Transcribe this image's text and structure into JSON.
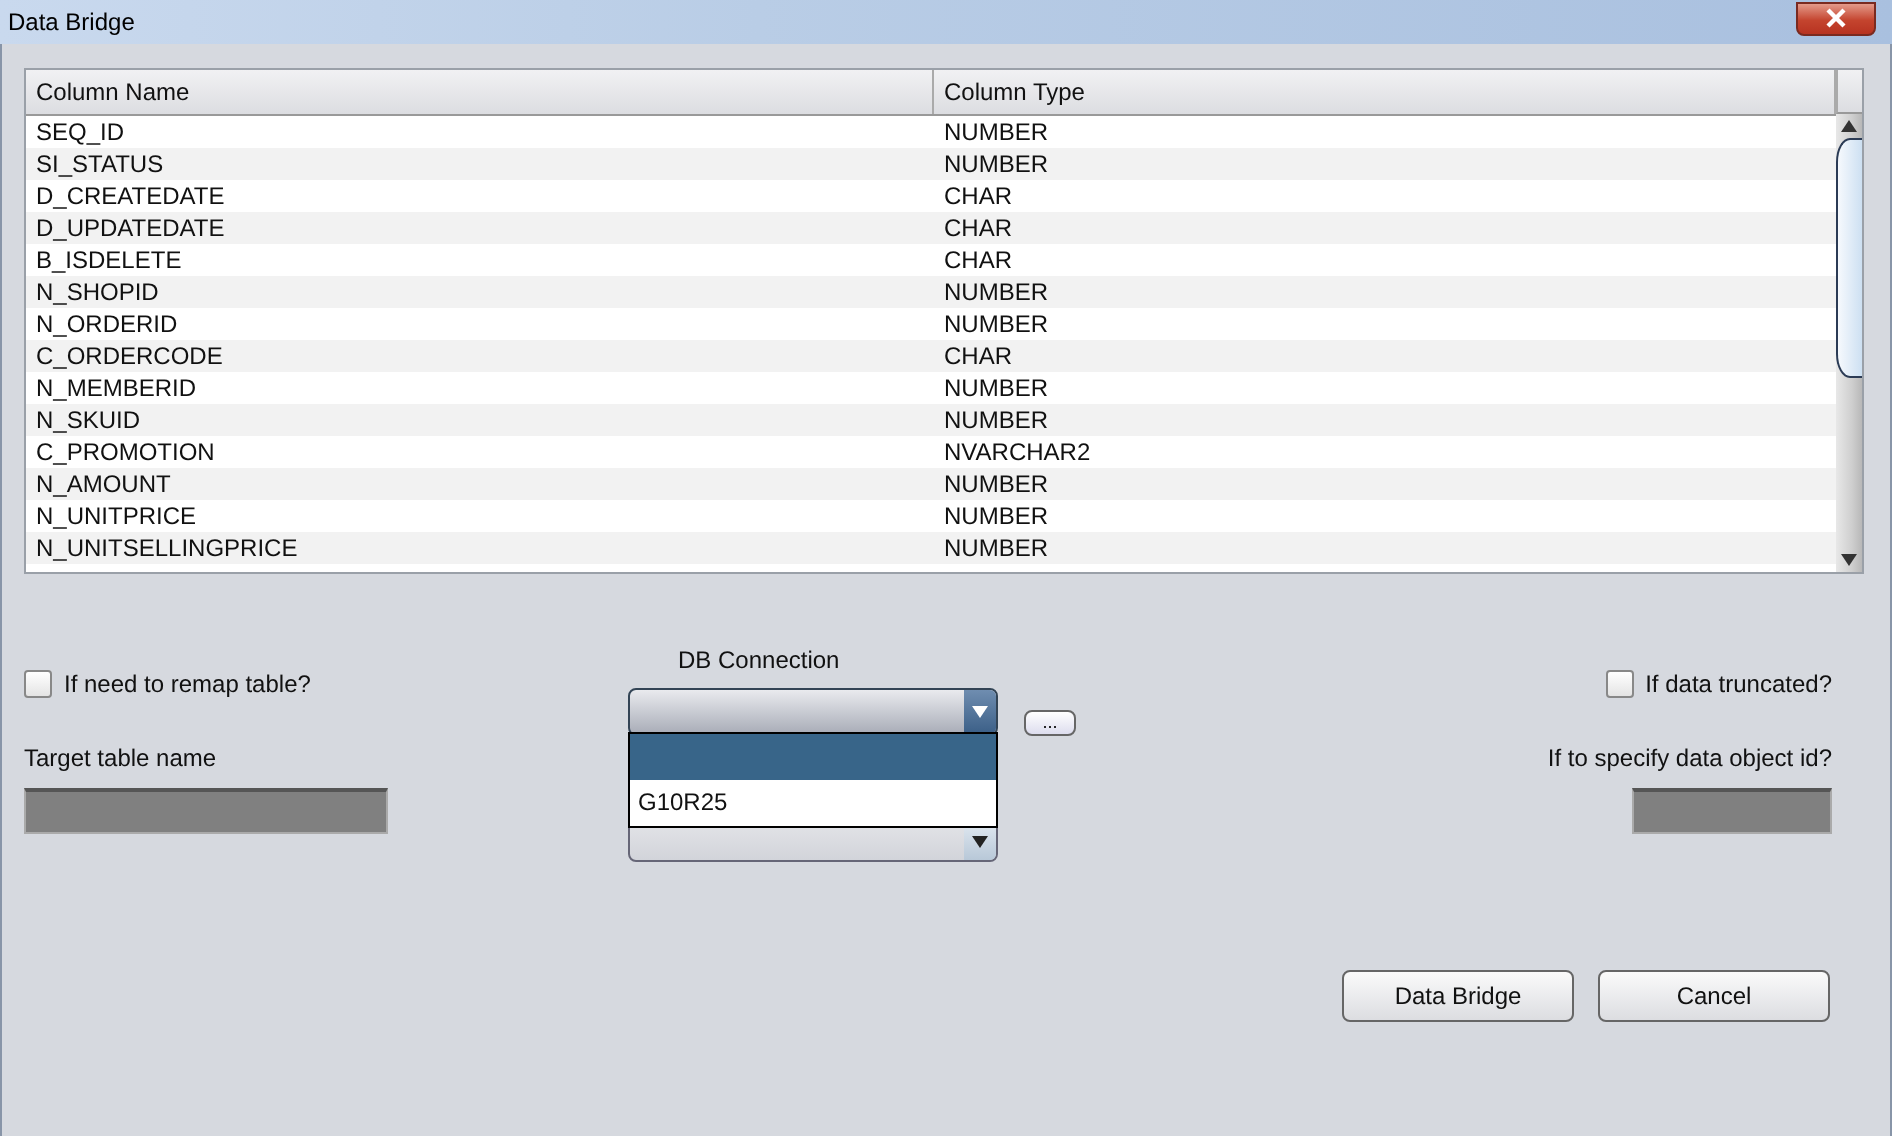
{
  "window": {
    "title": "Data Bridge"
  },
  "table": {
    "columns": [
      "Column Name",
      "Column Type"
    ],
    "rows": [
      {
        "name": "SEQ_ID",
        "type": "NUMBER"
      },
      {
        "name": "SI_STATUS",
        "type": "NUMBER"
      },
      {
        "name": "D_CREATEDATE",
        "type": "CHAR"
      },
      {
        "name": "D_UPDATEDATE",
        "type": "CHAR"
      },
      {
        "name": "B_ISDELETE",
        "type": "CHAR"
      },
      {
        "name": "N_SHOPID",
        "type": "NUMBER"
      },
      {
        "name": "N_ORDERID",
        "type": "NUMBER"
      },
      {
        "name": "C_ORDERCODE",
        "type": "CHAR"
      },
      {
        "name": "N_MEMBERID",
        "type": "NUMBER"
      },
      {
        "name": "N_SKUID",
        "type": "NUMBER"
      },
      {
        "name": "C_PROMOTION",
        "type": "NVARCHAR2"
      },
      {
        "name": "N_AMOUNT",
        "type": "NUMBER"
      },
      {
        "name": "N_UNITPRICE",
        "type": "NUMBER"
      },
      {
        "name": "N_UNITSELLINGPRICE",
        "type": "NUMBER"
      }
    ]
  },
  "remap": {
    "label": "If need to remap table?",
    "checked": false
  },
  "target_table": {
    "label": "Target table name"
  },
  "db_connection": {
    "label": "DB Connection",
    "browse_button": "...",
    "options": [
      {
        "selected": true
      },
      {
        "label": "G10R25",
        "selected": false
      }
    ]
  },
  "truncated": {
    "label": "If data truncated?",
    "checked": false
  },
  "object_id": {
    "label": "If to specify data object id?"
  },
  "buttons": [
    "Data Bridge",
    "Cancel"
  ]
}
